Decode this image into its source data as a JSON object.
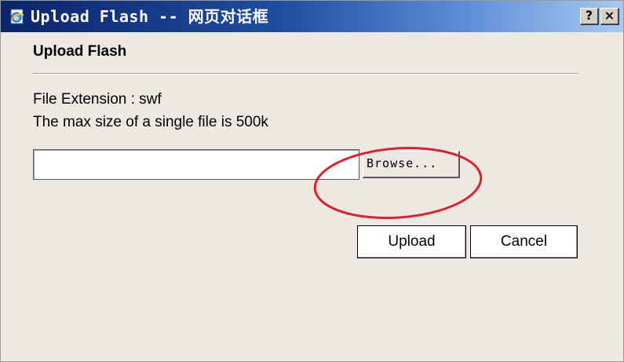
{
  "window": {
    "title": "Upload Flash -- 网页对话框",
    "help_label": "?",
    "close_label": "×"
  },
  "dialog": {
    "heading": "Upload Flash",
    "file_extension_text": "File Extension : swf",
    "max_size_text": "The max size of a single file is 500k",
    "file_input_value": "",
    "browse_label": "Browse...",
    "upload_label": "Upload",
    "cancel_label": "Cancel"
  },
  "annotation": {
    "highlight_color": "#e0202a"
  },
  "colors": {
    "titlebar_start": "#0a246a",
    "titlebar_end": "#a6caf0",
    "dialog_background": "#ece9e3"
  }
}
